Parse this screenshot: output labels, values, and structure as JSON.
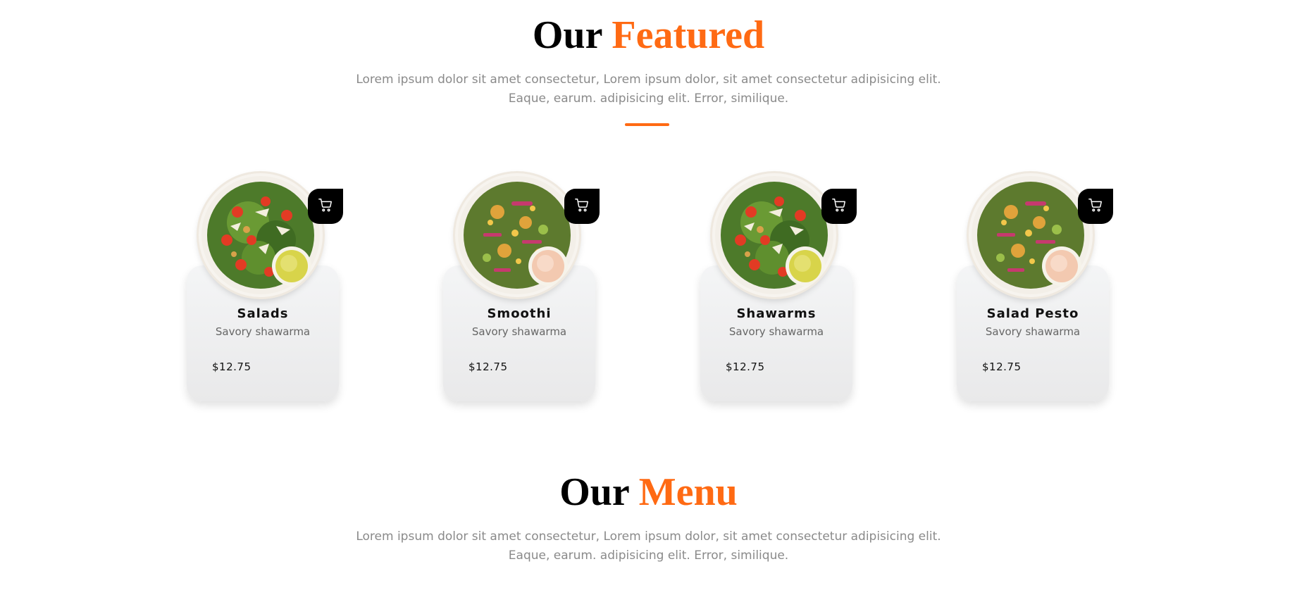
{
  "featured": {
    "title_main": "Our",
    "title_accent": "Featured",
    "desc_line1": "Lorem ipsum dolor sit amet consectetur, Lorem ipsum dolor, sit amet consectetur adipisicing elit.",
    "desc_line2": "Eaque, earum. adipisicing elit. Error, similique.",
    "items": [
      {
        "name": "Salads",
        "subtitle": "Savory shawarma",
        "price": "$12.75",
        "image": "salad-bowl-icon"
      },
      {
        "name": "Smoothi",
        "subtitle": "Savory shawarma",
        "price": "$12.75",
        "image": "grain-bowl-icon"
      },
      {
        "name": "Shawarms",
        "subtitle": "Savory shawarma",
        "price": "$12.75",
        "image": "salad-bowl-icon"
      },
      {
        "name": "Salad Pesto",
        "subtitle": "Savory shawarma",
        "price": "$12.75",
        "image": "grain-bowl-icon"
      }
    ]
  },
  "menu": {
    "title_main": "Our",
    "title_accent": "Menu",
    "desc_line1": "Lorem ipsum dolor sit amet consectetur, Lorem ipsum dolor, sit amet consectetur adipisicing elit.",
    "desc_line2": "Eaque, earum. adipisicing elit. Error, similique."
  },
  "colors": {
    "accent": "#ff6a13",
    "cart_button": "#000000",
    "card_bg": "#eeeeef"
  },
  "icons": {
    "cart": "shopping-cart-icon"
  }
}
